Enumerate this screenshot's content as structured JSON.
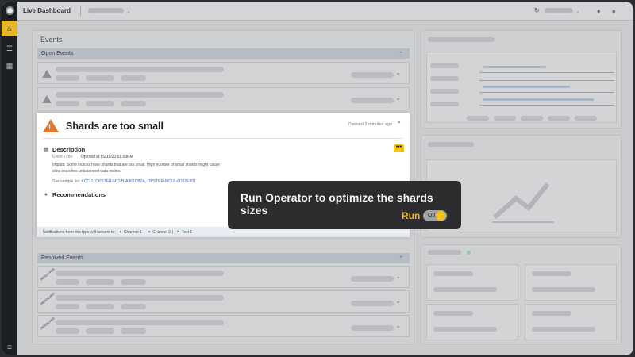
{
  "app": {
    "title": "Live Dashboard"
  },
  "topbar": {
    "refresh_icon": "refresh-icon",
    "bell_icon": "bell-icon",
    "user_icon": "user-icon"
  },
  "sidebar": {
    "items": [
      "home-icon",
      "stack-icon",
      "library-icon"
    ],
    "menu_icon": "menu-icon"
  },
  "events_panel": {
    "title": "Events",
    "open_section": "Open Events",
    "resolved_section": "Resolved Events",
    "resolved_tag": "RESOLVED"
  },
  "event_card": {
    "title": "Shards are too small",
    "opened": "Opened 2 minutes ago",
    "description_title": "Description",
    "event_time_label": "Event Time:",
    "event_time_value": "Opened at 01/15/20 01:03PM",
    "impact": "Impact: Some indices have shards that are too small. High number of small shards might cause slow searches unbalanced data nodes.",
    "sample_label": "See sample list:",
    "sample_list": "ACC-1, OPSTER-MCLB-A961CB2A, OPSTER-MCLB-6D82E801",
    "recommendations_title": "Recommendations",
    "more_label": "•••",
    "footer": {
      "prefix": "Notifications from this type will be sent to:",
      "channels": [
        "Channel 1",
        "Channel 2",
        "Test 1"
      ],
      "separator": "|"
    }
  },
  "tooltip": {
    "text": "Run Operator to optimize the shards sizes",
    "run_label": "Run",
    "toggle_label": "On",
    "toggle_on": true
  },
  "colors": {
    "accent": "#f1c21b",
    "warning": "#e2772f",
    "rail": "#1c1f24",
    "link": "#3c68b3"
  }
}
